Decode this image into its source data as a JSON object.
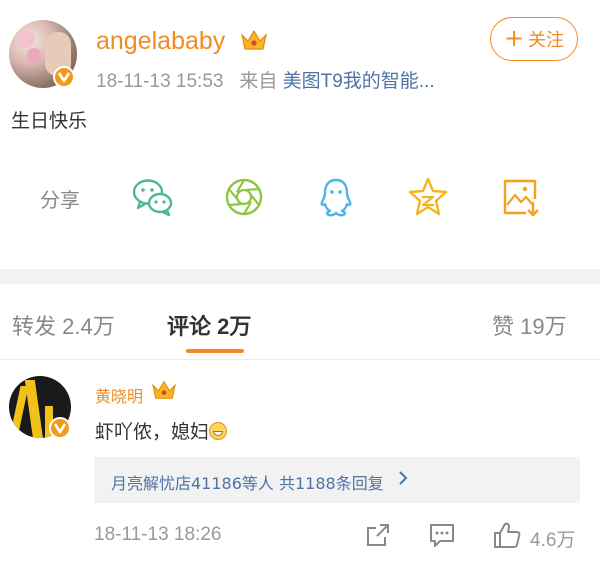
{
  "post": {
    "username": "angelababy",
    "timestamp": "18-11-13 15:53",
    "source_prefix": "来自",
    "source": "美图T9我的智能...",
    "follow_label": "关注",
    "body": "生日快乐"
  },
  "share": {
    "label": "分享",
    "icons": [
      "wechat-icon",
      "moments-icon",
      "qq-icon",
      "qzone-icon",
      "save-image-icon"
    ]
  },
  "tabs": [
    {
      "label": "转发 2.4万"
    },
    {
      "label": "评论 2万"
    },
    {
      "label": "赞 19万"
    }
  ],
  "comment": {
    "username": "黄晓明",
    "text": "虾吖侬，媳妇",
    "replies_summary": "月亮解忧店41186等人  共1188条回复",
    "timestamp": "18-11-13 18:26",
    "like_count": "4.6万"
  },
  "colors": {
    "accent": "#f08c21",
    "link": "#4e73a5",
    "muted": "#999999"
  }
}
